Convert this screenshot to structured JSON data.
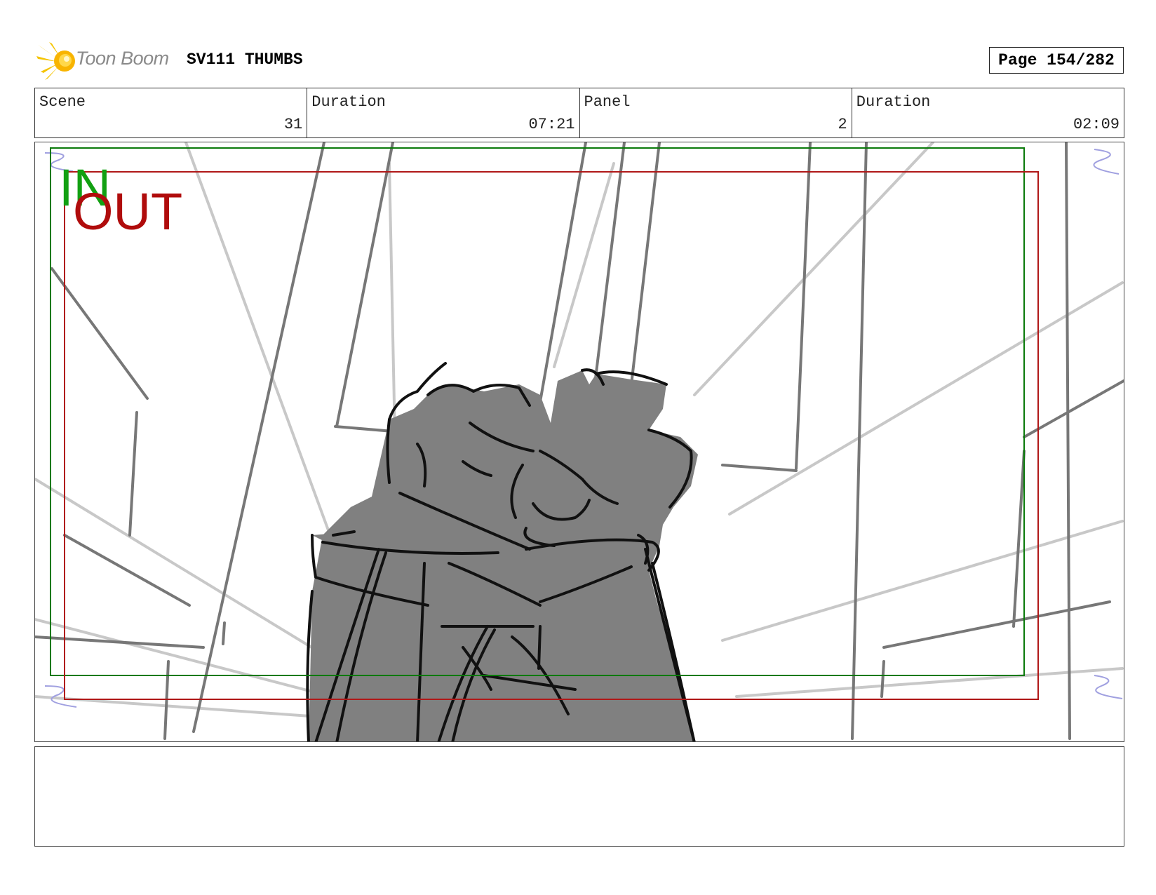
{
  "header": {
    "logo_text": "Toon Boom",
    "project_title": "SV111 THUMBS",
    "page_label": "Page 154/282"
  },
  "info": {
    "scene": {
      "label": "Scene",
      "value": "31"
    },
    "scene_duration": {
      "label": "Duration",
      "value": "07:21"
    },
    "panel": {
      "label": "Panel",
      "value": "2"
    },
    "panel_duration": {
      "label": "Duration",
      "value": "02:09"
    }
  },
  "frame": {
    "in_label": "IN",
    "out_label": "OUT",
    "in_color": "#12a012",
    "out_color": "#b00c0c"
  },
  "notes": {
    "text": ""
  }
}
